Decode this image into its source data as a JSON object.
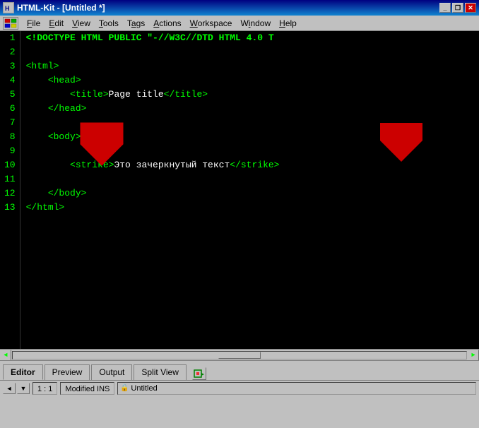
{
  "window": {
    "title": "HTML-Kit - [Untitled *]",
    "icon": "html-kit-icon"
  },
  "titlebar": {
    "title": "HTML-Kit - [Untitled *]",
    "minimize_label": "_",
    "restore_label": "❐",
    "close_label": "✕"
  },
  "menubar": {
    "items": [
      {
        "id": "file",
        "label": "File",
        "underline_char": "F"
      },
      {
        "id": "edit",
        "label": "Edit",
        "underline_char": "E"
      },
      {
        "id": "view",
        "label": "View",
        "underline_char": "V"
      },
      {
        "id": "tools",
        "label": "Tools",
        "underline_char": "T"
      },
      {
        "id": "tags",
        "label": "Tags",
        "underline_char": "a"
      },
      {
        "id": "actions",
        "label": "Actions",
        "underline_char": "A"
      },
      {
        "id": "workspace",
        "label": "Workspace",
        "underline_char": "W"
      },
      {
        "id": "window",
        "label": "Window",
        "underline_char": "i"
      },
      {
        "id": "help",
        "label": "Help",
        "underline_char": "H"
      }
    ]
  },
  "code": {
    "lines": [
      {
        "num": 1,
        "content": "<!DOCTYPE HTML PUBLIC \"-//W3C//DTD HTML 4.0 T",
        "type": "doctype"
      },
      {
        "num": 2,
        "content": "",
        "type": "empty"
      },
      {
        "num": 3,
        "content": "<html>",
        "type": "tag"
      },
      {
        "num": 4,
        "content": "    <head>",
        "type": "tag"
      },
      {
        "num": 5,
        "content": "        <title>Page title</title>",
        "type": "mixed"
      },
      {
        "num": 6,
        "content": "    </head>",
        "type": "tag"
      },
      {
        "num": 7,
        "content": "",
        "type": "empty"
      },
      {
        "num": 8,
        "content": "    <body>",
        "type": "tag"
      },
      {
        "num": 9,
        "content": "",
        "type": "empty"
      },
      {
        "num": 10,
        "content": "        <strike>Это зачеркнутый текст</strike>",
        "type": "mixed"
      },
      {
        "num": 11,
        "content": "",
        "type": "empty"
      },
      {
        "num": 12,
        "content": "    </body>",
        "type": "tag"
      },
      {
        "num": 13,
        "content": "</html>",
        "type": "tag"
      }
    ]
  },
  "tabs": {
    "items": [
      {
        "id": "editor",
        "label": "Editor",
        "active": true
      },
      {
        "id": "preview",
        "label": "Preview",
        "active": false
      },
      {
        "id": "output",
        "label": "Output",
        "active": false
      },
      {
        "id": "split-view",
        "label": "Split View",
        "active": false
      }
    ]
  },
  "statusbar": {
    "position": "1 : 1",
    "state": "Modified INS",
    "lock_icon": "🔒",
    "filename": "Untitled"
  },
  "scrollbar": {
    "left_arrow": "◄",
    "right_arrow": "►"
  }
}
